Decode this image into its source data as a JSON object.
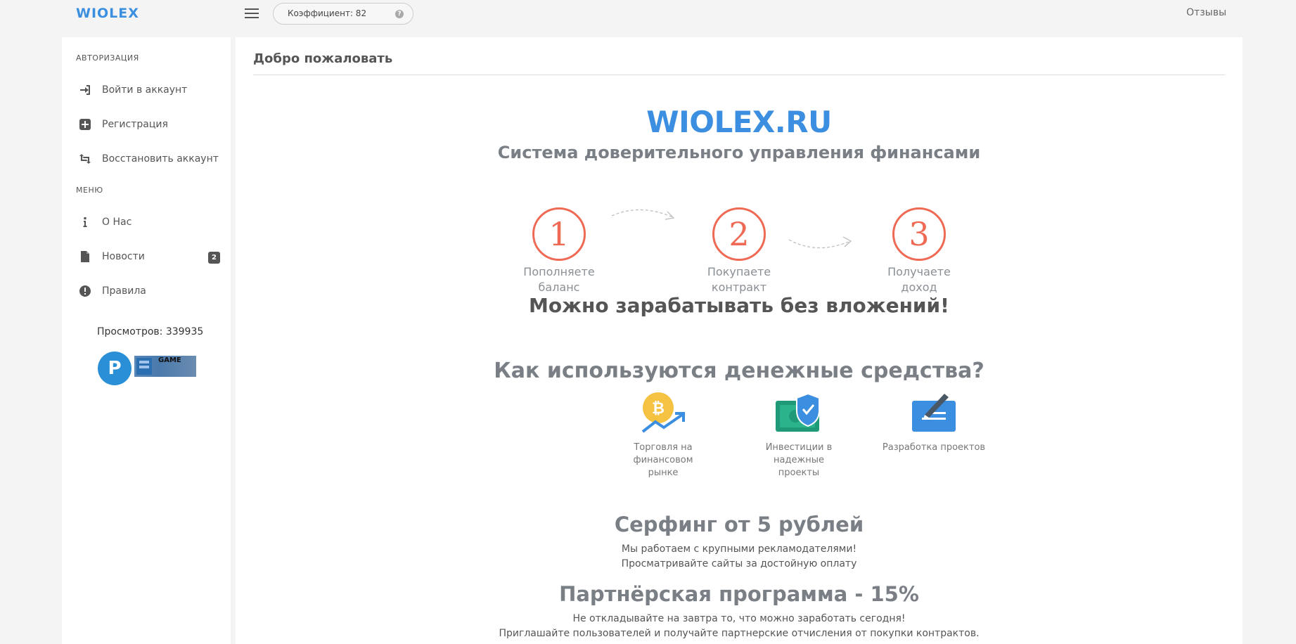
{
  "header": {
    "brand": "WIOLEX",
    "coefficient_label": "Коэффициент: 82",
    "help_glyph": "?",
    "reviews_label": "Отзывы"
  },
  "sidebar": {
    "auth_heading": "АВТОРИЗАЦИЯ",
    "auth_items": [
      {
        "label": "Войти в аккаунт",
        "icon": "sign-in-icon"
      },
      {
        "label": "Регистрация",
        "icon": "plus-square-icon"
      },
      {
        "label": "Восстановить аккаунт",
        "icon": "retweet-icon"
      }
    ],
    "menu_heading": "МЕНЮ",
    "menu_items": [
      {
        "label": "О Нас",
        "icon": "info-icon"
      },
      {
        "label": "Новости",
        "icon": "file-icon",
        "badge": "2"
      },
      {
        "label": "Правила",
        "icon": "exclamation-circle-icon"
      }
    ],
    "views": "Просмотров: 339935",
    "banner_p": "P",
    "banner_game": "GAME"
  },
  "main": {
    "title": "Добро пожаловать",
    "logo": "WIOLEX.RU",
    "tagline": "Система доверительного управления финансами",
    "steps": [
      {
        "num": "1",
        "line1": "Пополняете",
        "line2": "баланс"
      },
      {
        "num": "2",
        "line1": "Покупаете",
        "line2": "контракт"
      },
      {
        "num": "3",
        "line1": "Получаете",
        "line2": "доход"
      }
    ],
    "headline": "Можно зарабатывать без вложений!",
    "how_title": "Как используются денежные средства?",
    "uses": [
      {
        "line1": "Торговля на финансовом",
        "line2": "рынке",
        "icon": "bitcoin-growth-icon"
      },
      {
        "line1": "Инвестиции в надежные",
        "line2": "проекты",
        "icon": "money-shield-icon"
      },
      {
        "line1": "Разработка проектов",
        "line2": "",
        "icon": "pen-board-icon"
      }
    ],
    "surf_title": "Серфинг от 5 рублей",
    "surf_line1": "Мы работаем с крупными рекламодателями!",
    "surf_line2": "Просматривайте сайты за достойную оплату",
    "partner_title": "Партнёрская программа - 15%",
    "partner_line1": "Не откладывайте на завтра то, что можно заработать сегодня!",
    "partner_line2": "Приглашайте пользователей и получайте партнерские отчисления от покупки контрактов."
  },
  "colors": {
    "brand": "#3b8ee0",
    "step_accent": "#ef6a54",
    "title_gray": "#7a7f86"
  }
}
